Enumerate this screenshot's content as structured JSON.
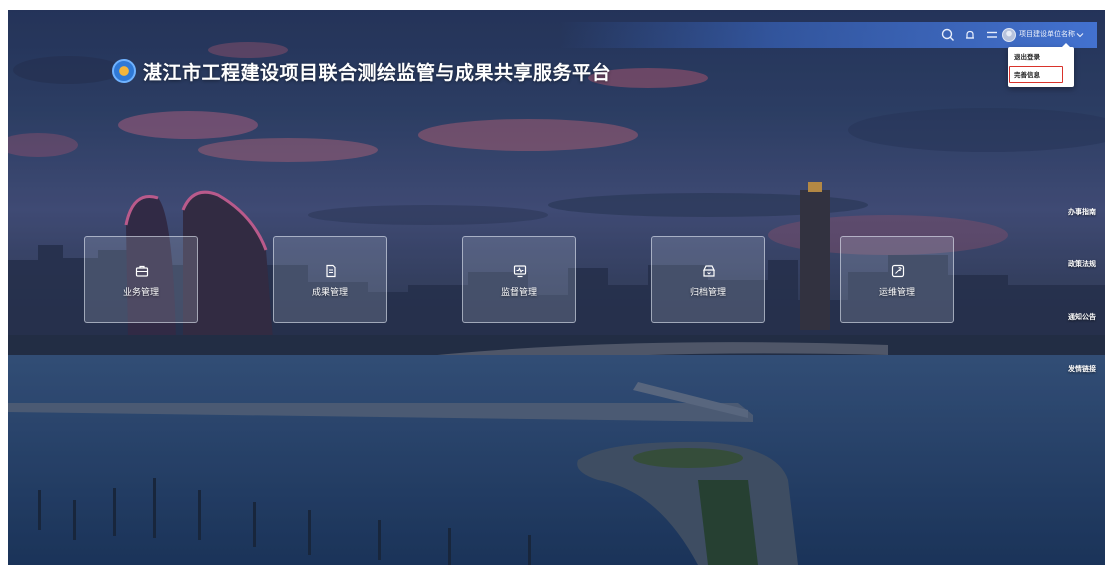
{
  "header": {
    "title": "湛江市工程建设项目联合测绘监管与成果共享服务平台",
    "logo_icon": "globe-logo-icon"
  },
  "topbar": {
    "icons": [
      "search-icon",
      "bell-icon",
      "menu-icon"
    ],
    "user_name": "项目建设单位名称",
    "accent_color": "#4a7fe0"
  },
  "user_menu": {
    "items": [
      {
        "label": "退出登录",
        "highlighted": false
      },
      {
        "label": "完善信息",
        "highlighted": true
      }
    ],
    "highlight_color": "#d9332b"
  },
  "modules": [
    {
      "label": "业务管理",
      "icon": "briefcase-icon"
    },
    {
      "label": "成果管理",
      "icon": "document-icon"
    },
    {
      "label": "监督管理",
      "icon": "monitor-icon"
    },
    {
      "label": "归档管理",
      "icon": "archive-box-icon"
    },
    {
      "label": "运维管理",
      "icon": "maintenance-icon"
    }
  ],
  "side_links": [
    "办事指南",
    "政策法规",
    "通知公告",
    "发情链接"
  ]
}
